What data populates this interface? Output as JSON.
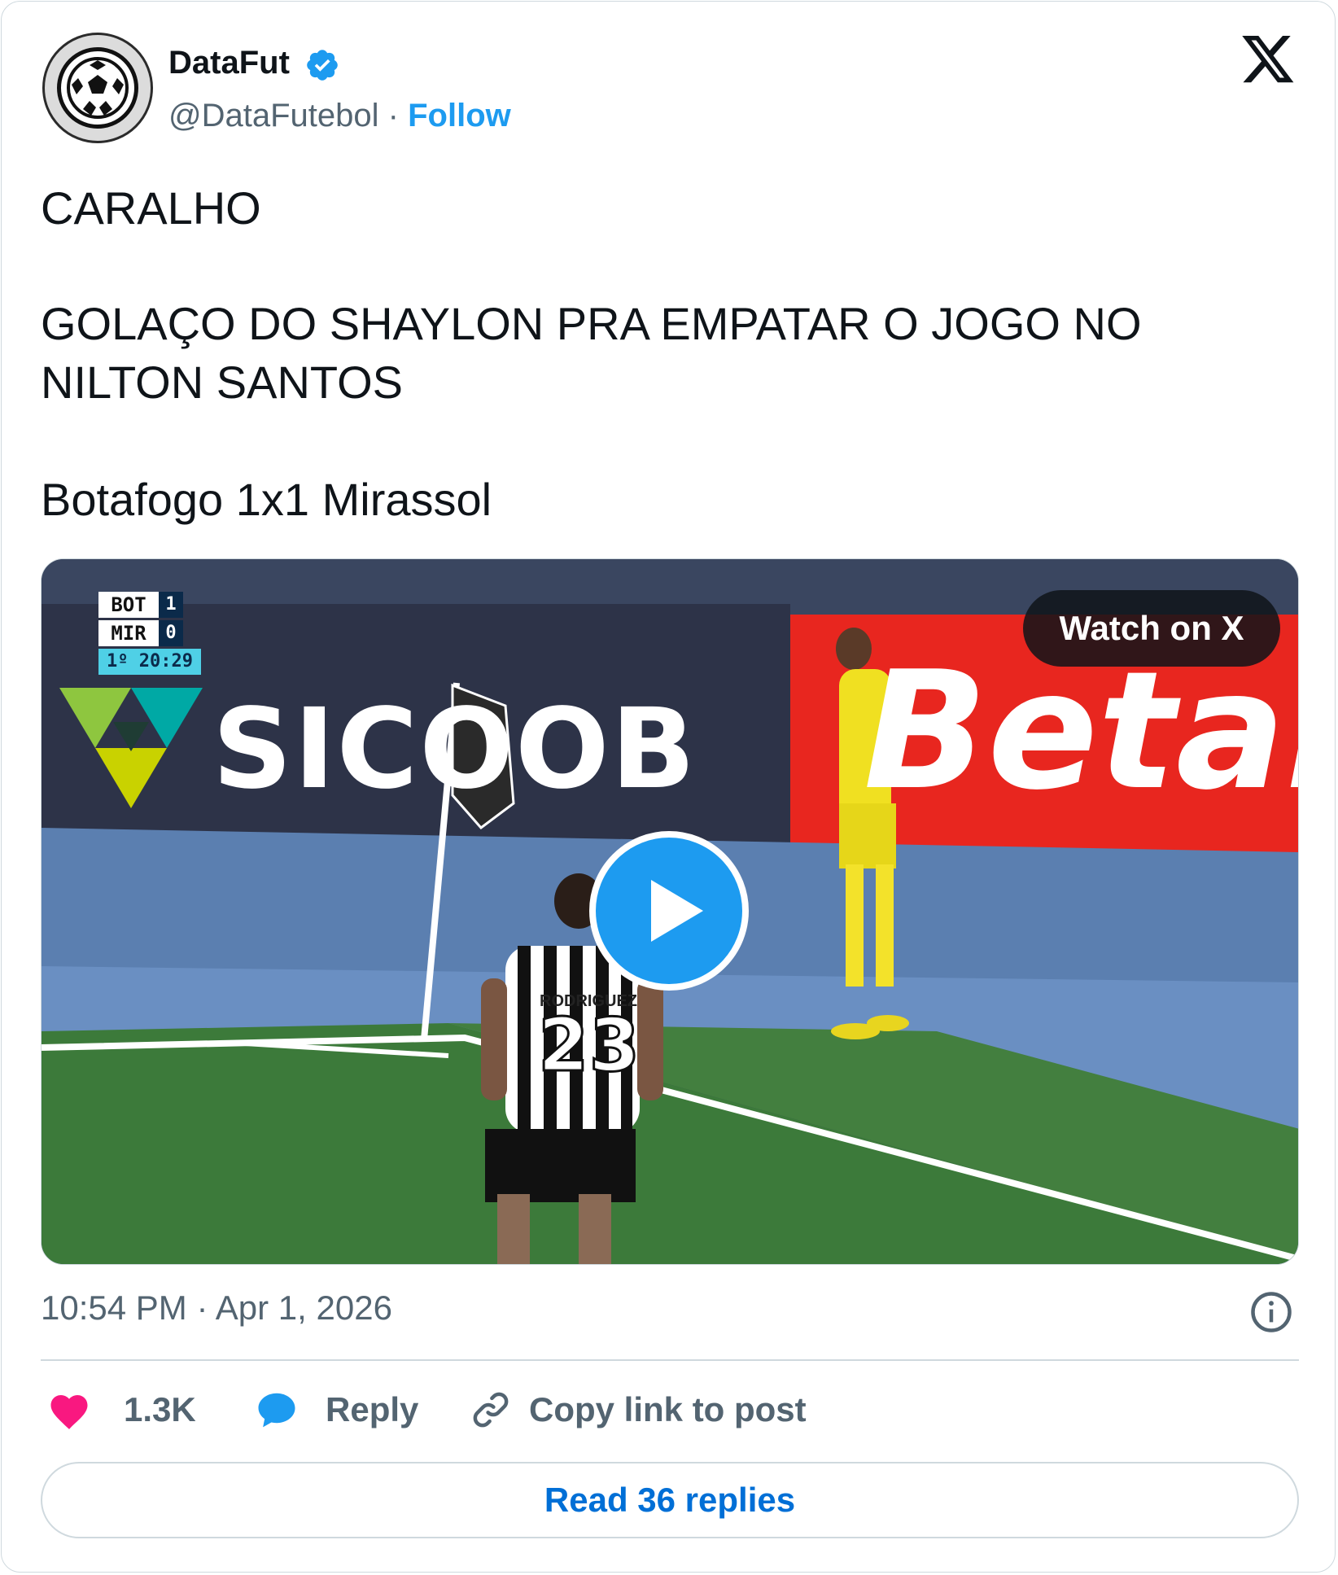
{
  "author": {
    "name": "DataFut",
    "handle": "@DataFutebol",
    "separator": "·",
    "follow_label": "Follow",
    "verified": true
  },
  "tweet": {
    "lines": [
      "CARALHO",
      "GOLAÇO DO SHAYLON PRA EMPATAR O JOGO NO",
      "NILTON SANTOS",
      "Botafogo 1x1 Mirassol"
    ]
  },
  "media": {
    "watch_label": "Watch on X",
    "scoreboard": {
      "home": "BOT",
      "home_score": "1",
      "away": "MIR",
      "away_score": "0",
      "clock": "1º 20:29"
    },
    "ad_boards": [
      "SICOOB",
      "Betan"
    ],
    "jersey_name": "RODRIGUEZ",
    "jersey_number": "23"
  },
  "meta": {
    "timestamp": "10:54 PM · Apr 1, 2026"
  },
  "actions": {
    "likes": "1.3K",
    "reply_label": "Reply",
    "copy_label": "Copy link to post"
  },
  "read_replies_label": "Read 36 replies",
  "colors": {
    "accent": "#1d9bf0",
    "like": "#f91880",
    "link": "#006fd6",
    "muted": "#536471"
  }
}
